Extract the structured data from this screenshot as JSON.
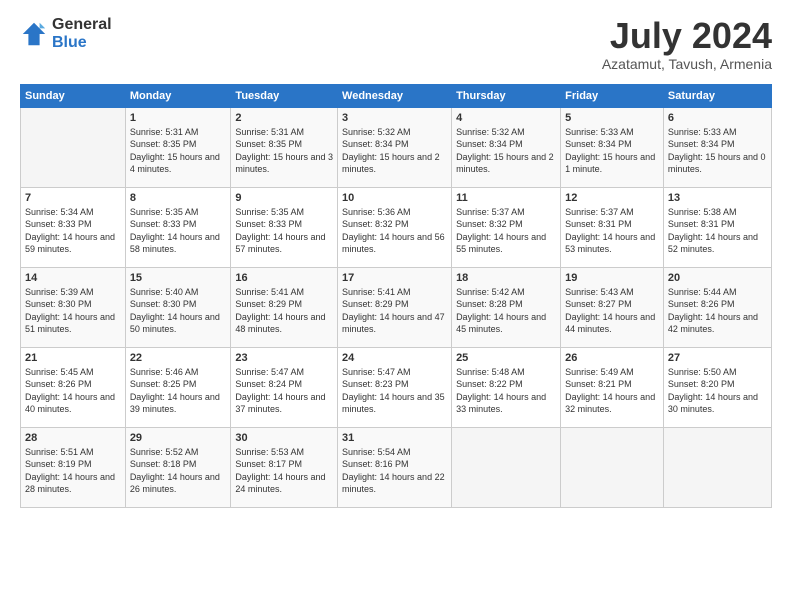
{
  "header": {
    "logo_line1": "General",
    "logo_line2": "Blue",
    "month_title": "July 2024",
    "subtitle": "Azatamut, Tavush, Armenia"
  },
  "weekdays": [
    "Sunday",
    "Monday",
    "Tuesday",
    "Wednesday",
    "Thursday",
    "Friday",
    "Saturday"
  ],
  "weeks": [
    [
      {
        "day": "",
        "sunrise": "",
        "sunset": "",
        "daylight": ""
      },
      {
        "day": "1",
        "sunrise": "Sunrise: 5:31 AM",
        "sunset": "Sunset: 8:35 PM",
        "daylight": "Daylight: 15 hours and 4 minutes."
      },
      {
        "day": "2",
        "sunrise": "Sunrise: 5:31 AM",
        "sunset": "Sunset: 8:35 PM",
        "daylight": "Daylight: 15 hours and 3 minutes."
      },
      {
        "day": "3",
        "sunrise": "Sunrise: 5:32 AM",
        "sunset": "Sunset: 8:34 PM",
        "daylight": "Daylight: 15 hours and 2 minutes."
      },
      {
        "day": "4",
        "sunrise": "Sunrise: 5:32 AM",
        "sunset": "Sunset: 8:34 PM",
        "daylight": "Daylight: 15 hours and 2 minutes."
      },
      {
        "day": "5",
        "sunrise": "Sunrise: 5:33 AM",
        "sunset": "Sunset: 8:34 PM",
        "daylight": "Daylight: 15 hours and 1 minute."
      },
      {
        "day": "6",
        "sunrise": "Sunrise: 5:33 AM",
        "sunset": "Sunset: 8:34 PM",
        "daylight": "Daylight: 15 hours and 0 minutes."
      }
    ],
    [
      {
        "day": "7",
        "sunrise": "Sunrise: 5:34 AM",
        "sunset": "Sunset: 8:33 PM",
        "daylight": "Daylight: 14 hours and 59 minutes."
      },
      {
        "day": "8",
        "sunrise": "Sunrise: 5:35 AM",
        "sunset": "Sunset: 8:33 PM",
        "daylight": "Daylight: 14 hours and 58 minutes."
      },
      {
        "day": "9",
        "sunrise": "Sunrise: 5:35 AM",
        "sunset": "Sunset: 8:33 PM",
        "daylight": "Daylight: 14 hours and 57 minutes."
      },
      {
        "day": "10",
        "sunrise": "Sunrise: 5:36 AM",
        "sunset": "Sunset: 8:32 PM",
        "daylight": "Daylight: 14 hours and 56 minutes."
      },
      {
        "day": "11",
        "sunrise": "Sunrise: 5:37 AM",
        "sunset": "Sunset: 8:32 PM",
        "daylight": "Daylight: 14 hours and 55 minutes."
      },
      {
        "day": "12",
        "sunrise": "Sunrise: 5:37 AM",
        "sunset": "Sunset: 8:31 PM",
        "daylight": "Daylight: 14 hours and 53 minutes."
      },
      {
        "day": "13",
        "sunrise": "Sunrise: 5:38 AM",
        "sunset": "Sunset: 8:31 PM",
        "daylight": "Daylight: 14 hours and 52 minutes."
      }
    ],
    [
      {
        "day": "14",
        "sunrise": "Sunrise: 5:39 AM",
        "sunset": "Sunset: 8:30 PM",
        "daylight": "Daylight: 14 hours and 51 minutes."
      },
      {
        "day": "15",
        "sunrise": "Sunrise: 5:40 AM",
        "sunset": "Sunset: 8:30 PM",
        "daylight": "Daylight: 14 hours and 50 minutes."
      },
      {
        "day": "16",
        "sunrise": "Sunrise: 5:41 AM",
        "sunset": "Sunset: 8:29 PM",
        "daylight": "Daylight: 14 hours and 48 minutes."
      },
      {
        "day": "17",
        "sunrise": "Sunrise: 5:41 AM",
        "sunset": "Sunset: 8:29 PM",
        "daylight": "Daylight: 14 hours and 47 minutes."
      },
      {
        "day": "18",
        "sunrise": "Sunrise: 5:42 AM",
        "sunset": "Sunset: 8:28 PM",
        "daylight": "Daylight: 14 hours and 45 minutes."
      },
      {
        "day": "19",
        "sunrise": "Sunrise: 5:43 AM",
        "sunset": "Sunset: 8:27 PM",
        "daylight": "Daylight: 14 hours and 44 minutes."
      },
      {
        "day": "20",
        "sunrise": "Sunrise: 5:44 AM",
        "sunset": "Sunset: 8:26 PM",
        "daylight": "Daylight: 14 hours and 42 minutes."
      }
    ],
    [
      {
        "day": "21",
        "sunrise": "Sunrise: 5:45 AM",
        "sunset": "Sunset: 8:26 PM",
        "daylight": "Daylight: 14 hours and 40 minutes."
      },
      {
        "day": "22",
        "sunrise": "Sunrise: 5:46 AM",
        "sunset": "Sunset: 8:25 PM",
        "daylight": "Daylight: 14 hours and 39 minutes."
      },
      {
        "day": "23",
        "sunrise": "Sunrise: 5:47 AM",
        "sunset": "Sunset: 8:24 PM",
        "daylight": "Daylight: 14 hours and 37 minutes."
      },
      {
        "day": "24",
        "sunrise": "Sunrise: 5:47 AM",
        "sunset": "Sunset: 8:23 PM",
        "daylight": "Daylight: 14 hours and 35 minutes."
      },
      {
        "day": "25",
        "sunrise": "Sunrise: 5:48 AM",
        "sunset": "Sunset: 8:22 PM",
        "daylight": "Daylight: 14 hours and 33 minutes."
      },
      {
        "day": "26",
        "sunrise": "Sunrise: 5:49 AM",
        "sunset": "Sunset: 8:21 PM",
        "daylight": "Daylight: 14 hours and 32 minutes."
      },
      {
        "day": "27",
        "sunrise": "Sunrise: 5:50 AM",
        "sunset": "Sunset: 8:20 PM",
        "daylight": "Daylight: 14 hours and 30 minutes."
      }
    ],
    [
      {
        "day": "28",
        "sunrise": "Sunrise: 5:51 AM",
        "sunset": "Sunset: 8:19 PM",
        "daylight": "Daylight: 14 hours and 28 minutes."
      },
      {
        "day": "29",
        "sunrise": "Sunrise: 5:52 AM",
        "sunset": "Sunset: 8:18 PM",
        "daylight": "Daylight: 14 hours and 26 minutes."
      },
      {
        "day": "30",
        "sunrise": "Sunrise: 5:53 AM",
        "sunset": "Sunset: 8:17 PM",
        "daylight": "Daylight: 14 hours and 24 minutes."
      },
      {
        "day": "31",
        "sunrise": "Sunrise: 5:54 AM",
        "sunset": "Sunset: 8:16 PM",
        "daylight": "Daylight: 14 hours and 22 minutes."
      },
      {
        "day": "",
        "sunrise": "",
        "sunset": "",
        "daylight": ""
      },
      {
        "day": "",
        "sunrise": "",
        "sunset": "",
        "daylight": ""
      },
      {
        "day": "",
        "sunrise": "",
        "sunset": "",
        "daylight": ""
      }
    ]
  ]
}
